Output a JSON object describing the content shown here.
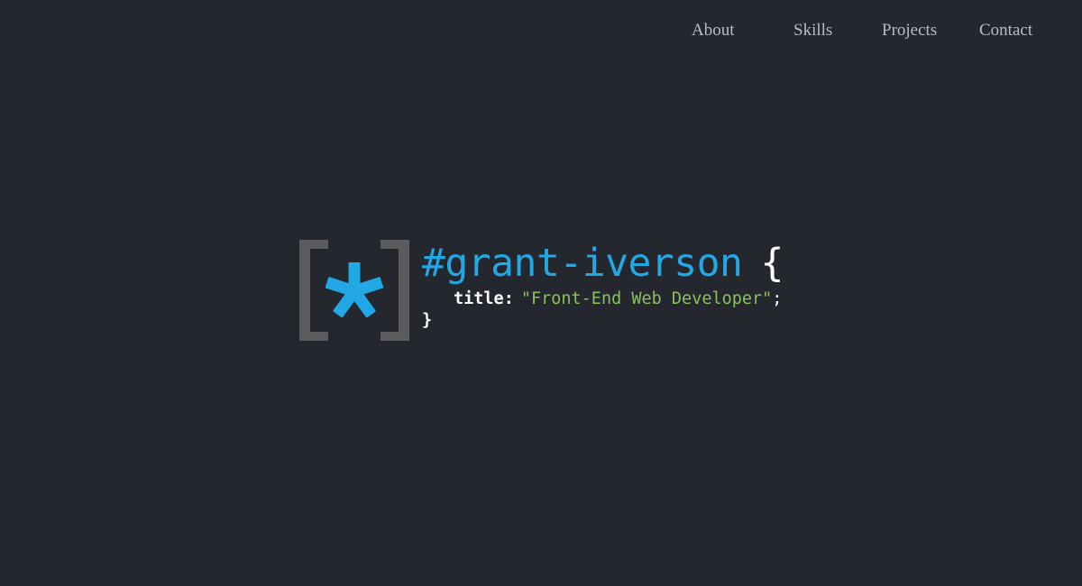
{
  "nav": {
    "items": [
      {
        "label": "About"
      },
      {
        "label": "Skills"
      },
      {
        "label": "Projects"
      },
      {
        "label": "Contact"
      }
    ]
  },
  "logo": {
    "icon": "bracket-asterisk-icon",
    "bracket_color": "#5c5c5e",
    "asterisk_color": "#22a8e4"
  },
  "hero": {
    "selector": "#grant-iverson",
    "brace_open": "{",
    "property": "title",
    "colon": ":",
    "value": "\"Front-End Web Developer\"",
    "semicolon": ";",
    "brace_close": "}"
  },
  "colors": {
    "background": "#24272e",
    "nav_text": "#b7bcc7",
    "accent_blue": "#22a8e4",
    "string_green": "#8cbf5e"
  }
}
